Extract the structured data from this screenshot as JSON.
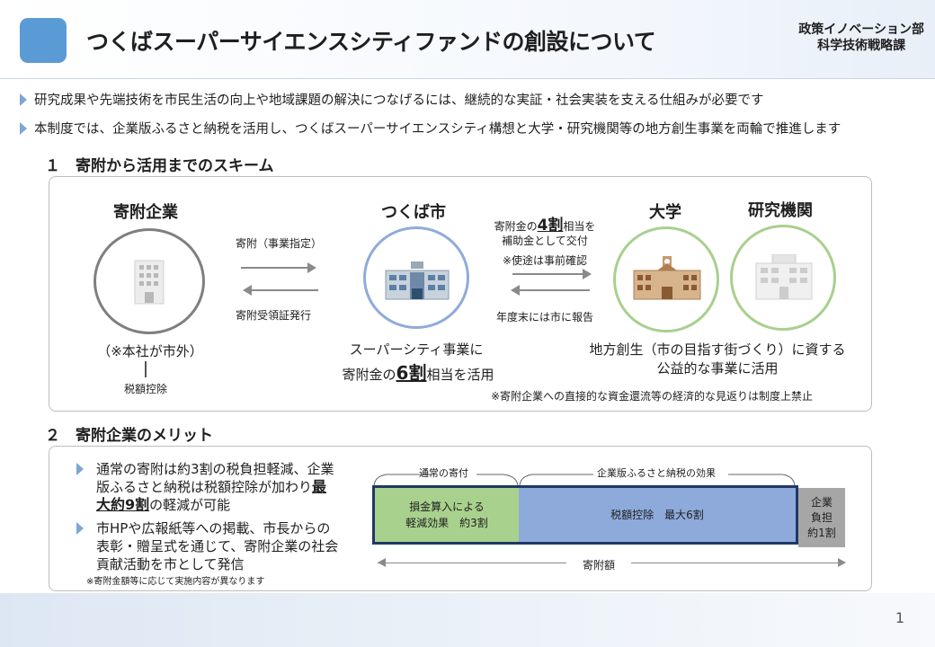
{
  "header": {
    "title": "つくばスーパーサイエンスシティファンドの創設について",
    "dept_line1": "政策イノベーション部",
    "dept_line2": "科学技術戦略課"
  },
  "bullets": [
    "研究成果や先端技術を市民生活の向上や地域課題の解決につなげるには、継続的な実証・社会実装を支える仕組みが必要です",
    "本制度では、企業版ふるさと納税を活用し、つくばスーパーサイエンスシティ構想と大学・研究機関等の地方創生事業を両輪で推進します"
  ],
  "section1": {
    "title": "１　寄附から活用までのスキーム",
    "company": {
      "label": "寄附企業",
      "note": "（※本社が市外）",
      "tax": "税額控除"
    },
    "arrow1": {
      "top": "寄附（事業指定）",
      "bottom": "寄附受領証発行"
    },
    "city": {
      "label": "つくば市",
      "desc_line1": "スーパーシティ事業に",
      "desc_pre": "寄附金の",
      "desc_big": "6割",
      "desc_post": "相当を活用"
    },
    "arrow2": {
      "top_pre": "寄附金の",
      "top_big": "4割",
      "top_post": "相当を",
      "top_line2": "補助金として交付",
      "top_line3": "※使途は事前確認",
      "bottom": "年度末には市に報告"
    },
    "univ": {
      "label": "大学"
    },
    "lab": {
      "label": "研究機関"
    },
    "univ_desc_line1": "地方創生（市の目指す街づくり）に資する",
    "univ_desc_line2": "公益的な事業に活用",
    "footnote": "※寄附企業への直接的な資金還流等の経済的な見返りは制度上禁止"
  },
  "section2": {
    "title": "２　寄附企業のメリット",
    "merit1_line1": "通常の寄附は約3割の税負担軽減、企業",
    "merit1_line2_pre": "版ふるさと納税は税額控除が加わり",
    "merit1_big1": "最",
    "merit1_big2": "大約9割",
    "merit1_line3_post": "の軽減が可能",
    "merit2_line1": "市HPや広報紙等への掲載、市長からの",
    "merit2_line2": "表彰・贈呈式を通じて、寄附企業の社会",
    "merit2_line3": "貢献活動を市として発信",
    "merit_note": "※寄附金額等に応じて実施内容が異なります",
    "brace1": "通常の寄付",
    "brace2": "企業版ふるさと納税の効果",
    "bar1_line1": "損金算入による",
    "bar1_line2": "軽減効果　約3割",
    "bar2": "税額控除　最大6割",
    "bar3_line1": "企業",
    "bar3_line2": "負担",
    "bar3_line3": "約1割",
    "axis_label": "寄附額"
  },
  "page_number": "1",
  "colors": {
    "accent": "#5b9bd5",
    "circle_gray": "#7f7f7f",
    "circle_blue": "#8fabd9",
    "circle_green": "#a8d08d",
    "bar_green": "#a9d18e",
    "bar_blue": "#8eaadb",
    "bar_gray": "#a6a6a6",
    "frame": "#1f3864"
  }
}
